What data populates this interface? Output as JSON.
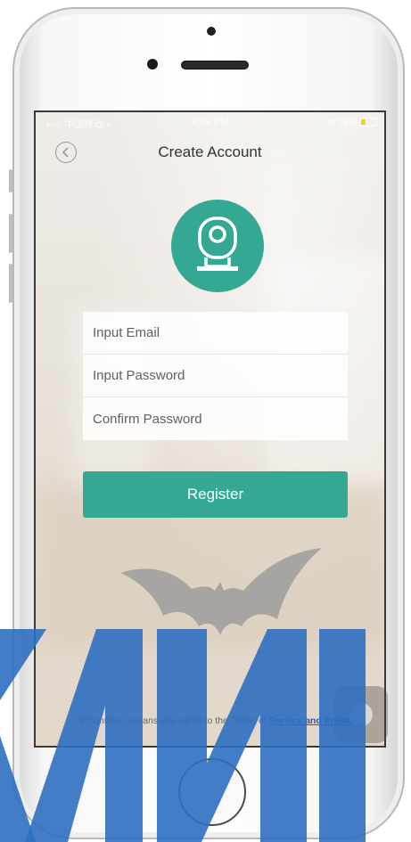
{
  "status_bar": {
    "carrier": "•○○ 中国移动 ≈",
    "time": "4:39 PM",
    "battery": "⊕ 24%"
  },
  "nav": {
    "title": "Create Account",
    "back_icon": "chevron-left-icon"
  },
  "logo_icon": "camera-icon",
  "form": {
    "email_placeholder": "Input Email",
    "password_placeholder": "Input Password",
    "confirm_placeholder": "Confirm Password"
  },
  "register": {
    "label": "Register"
  },
  "terms": {
    "prefix": "If Continue, means you agree to the Terms of ",
    "link": "Service and Privacy"
  },
  "colors": {
    "accent": "#35a894",
    "link": "#2d4fb8",
    "watermark": "#2f6fc1"
  }
}
